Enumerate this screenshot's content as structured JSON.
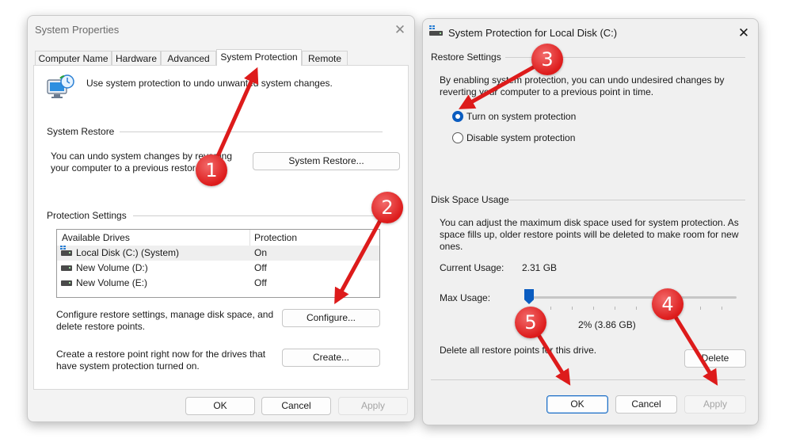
{
  "sys_props": {
    "title": "System Properties",
    "tabs": [
      {
        "label": "Computer Name"
      },
      {
        "label": "Hardware"
      },
      {
        "label": "Advanced"
      },
      {
        "label": "System Protection"
      },
      {
        "label": "Remote"
      }
    ],
    "intro": "Use system protection to undo unwanted system changes.",
    "restore_group": "System Restore",
    "restore_text": "You can undo system changes by reverting your computer to a previous restore point.",
    "restore_button": "System Restore...",
    "protection_group": "Protection Settings",
    "drives_header": {
      "drive": "Available Drives",
      "protection": "Protection"
    },
    "drives": [
      {
        "name": "Local Disk (C:) (System)",
        "protection": "On"
      },
      {
        "name": "New Volume (D:)",
        "protection": "Off"
      },
      {
        "name": "New Volume (E:)",
        "protection": "Off"
      }
    ],
    "configure_text": "Configure restore settings, manage disk space, and delete restore points.",
    "configure_button": "Configure...",
    "create_text": "Create a restore point right now for the drives that have system protection turned on.",
    "create_button": "Create...",
    "ok": "OK",
    "cancel": "Cancel",
    "apply": "Apply"
  },
  "protect_dialog": {
    "title": "System Protection for Local Disk (C:)",
    "restore_group": "Restore Settings",
    "restore_desc": "By enabling system protection, you can undo undesired changes by reverting your computer to a previous point in time.",
    "option_on": "Turn on system protection",
    "option_off": "Disable system protection",
    "selected_option": "on",
    "disk_group": "Disk Space Usage",
    "disk_desc": "You can adjust the maximum disk space used for system protection. As space fills up, older restore points will be deleted to make room for new ones.",
    "current_usage_label": "Current Usage:",
    "current_usage_value": "2.31 GB",
    "max_usage_label": "Max Usage:",
    "max_usage_percent": 2,
    "max_usage_text": "2% (3.86 GB)",
    "delete_text": "Delete all restore points for this drive.",
    "delete_button": "Delete",
    "ok": "OK",
    "cancel": "Cancel",
    "apply": "Apply"
  },
  "annotations": {
    "badges": [
      "1",
      "2",
      "3",
      "4",
      "5"
    ],
    "color": "#dd1b1b"
  },
  "colors": {
    "accent": "#0a5cc0",
    "window_bg": "#f3f3f3"
  }
}
